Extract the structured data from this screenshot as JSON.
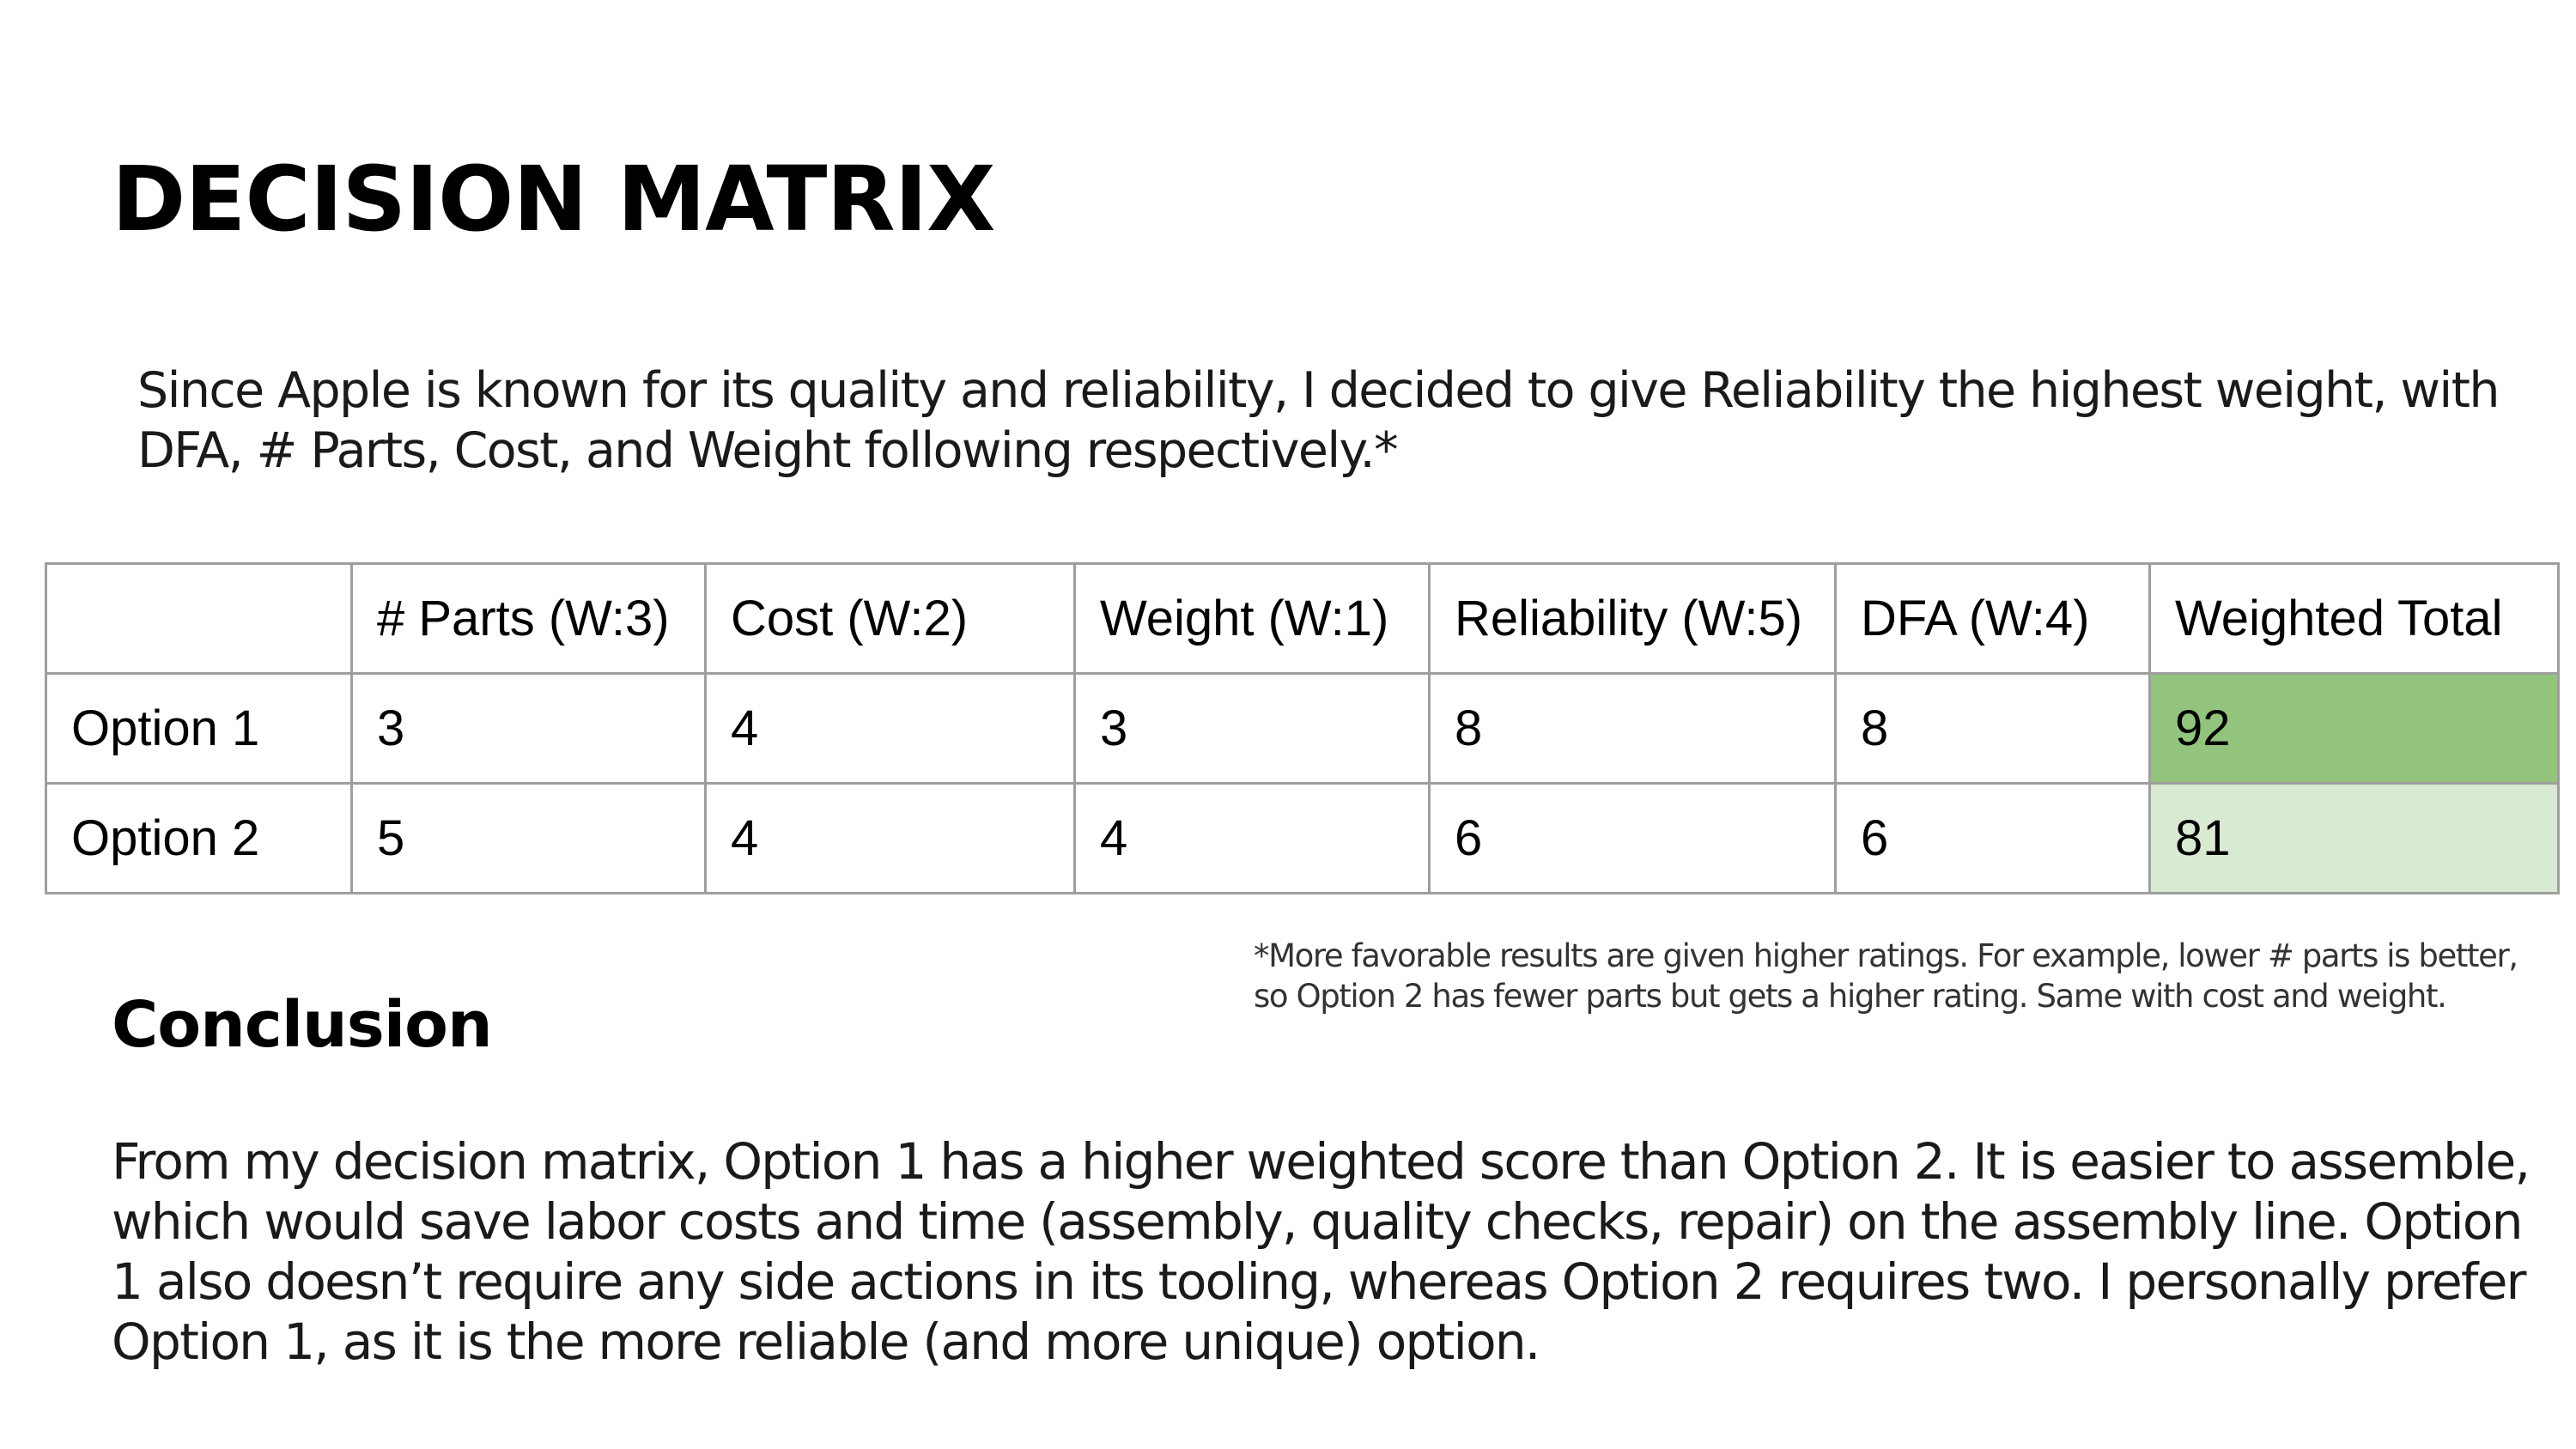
{
  "slide": {
    "title": "DECISION MATRIX",
    "intro": "Since Apple is known for its quality and reliability, I decided to give Reliability the highest weight, with DFA, # Parts, Cost, and Weight following respectively.*",
    "footnote": "*More favorable results are given higher ratings. For example, lower # parts is better, so Option 2 has fewer parts but gets a higher rating. Same with cost and weight.",
    "conclusion_heading": "Conclusion",
    "conclusion_body": "From my decision matrix, Option 1 has a higher weighted score than Option 2. It is easier to assemble, which would save labor costs and time (assembly, quality checks, repair) on the assembly line. Option 1 also doesn’t require any side actions in its tooling, whereas Option 2 requires two. I personally prefer Option 1, as it is the more reliable (and more unique) option."
  },
  "table": {
    "headers": [
      "",
      "# Parts (W:3)",
      "Cost (W:2)",
      "Weight (W:1)",
      "Reliability (W:5)",
      "DFA (W:4)",
      "Weighted Total"
    ],
    "rows": [
      [
        "Option 1",
        "3",
        "4",
        "3",
        "8",
        "8",
        "92"
      ],
      [
        "Option 2",
        "5",
        "4",
        "4",
        "6",
        "6",
        "81"
      ]
    ],
    "highlight_colors": {
      "best_total": "#93c47d",
      "second_total": "#d9ead3"
    }
  }
}
